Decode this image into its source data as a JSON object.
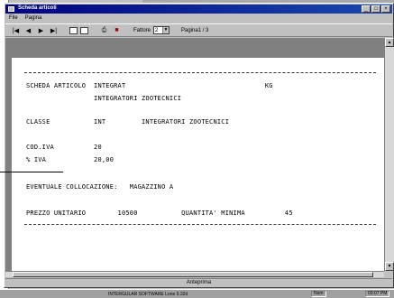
{
  "window": {
    "title": "Scheda articoli",
    "minimize": "_",
    "maximize": "□",
    "close": "×"
  },
  "menu": [
    "File",
    "Pagina"
  ],
  "toolbar": {
    "zoom_label": "Fattore",
    "zoom_value": "2",
    "page_label": "Pagina1 / 3"
  },
  "report": {
    "line1": "SCHEDA ARTICOLO  INTEGRAT                                   KG",
    "line2": "                 INTEGRATORI ZOOTECNICI",
    "line3": "CLASSE           INT         INTEGRATORI ZOOTECNICI",
    "line4": "COD.IVA          20",
    "line5": "% IVA            20,00",
    "line6": "EVENTUALE COLLOCAZIONE:   MAGAZZINO A",
    "line7": "PREZZO UNITARIO        10500           QUANTITA' MINIMA          45"
  },
  "status": {
    "center": "Anteprima"
  },
  "taskbar": {
    "text": "INTERGULAR SOFTWARE   Lone 9.32d",
    "cell1": "Num",
    "cell2": "03:07 PM"
  }
}
